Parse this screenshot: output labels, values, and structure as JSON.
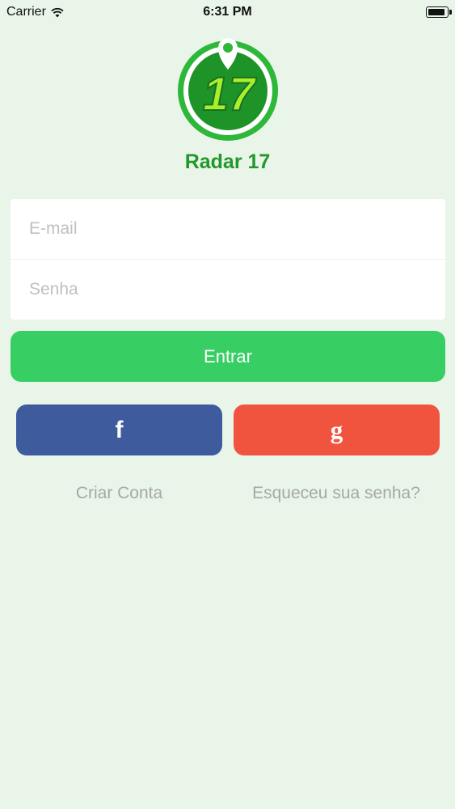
{
  "status_bar": {
    "carrier": "Carrier",
    "time": "6:31 PM"
  },
  "brand": {
    "logo_text": "17",
    "app_name": "Radar 17",
    "colors": {
      "primary_green": "#21982b",
      "button_green": "#37cf64",
      "facebook_blue": "#3e5b9d",
      "google_red": "#f0543f",
      "background": "#e9f5e8"
    }
  },
  "login_form": {
    "email_placeholder": "E-mail",
    "password_placeholder": "Senha",
    "submit_label": "Entrar"
  },
  "social": {
    "facebook_icon": "f",
    "google_icon": "g"
  },
  "links": {
    "create_account": "Criar Conta",
    "forgot_password": "Esqueceu sua senha?"
  }
}
